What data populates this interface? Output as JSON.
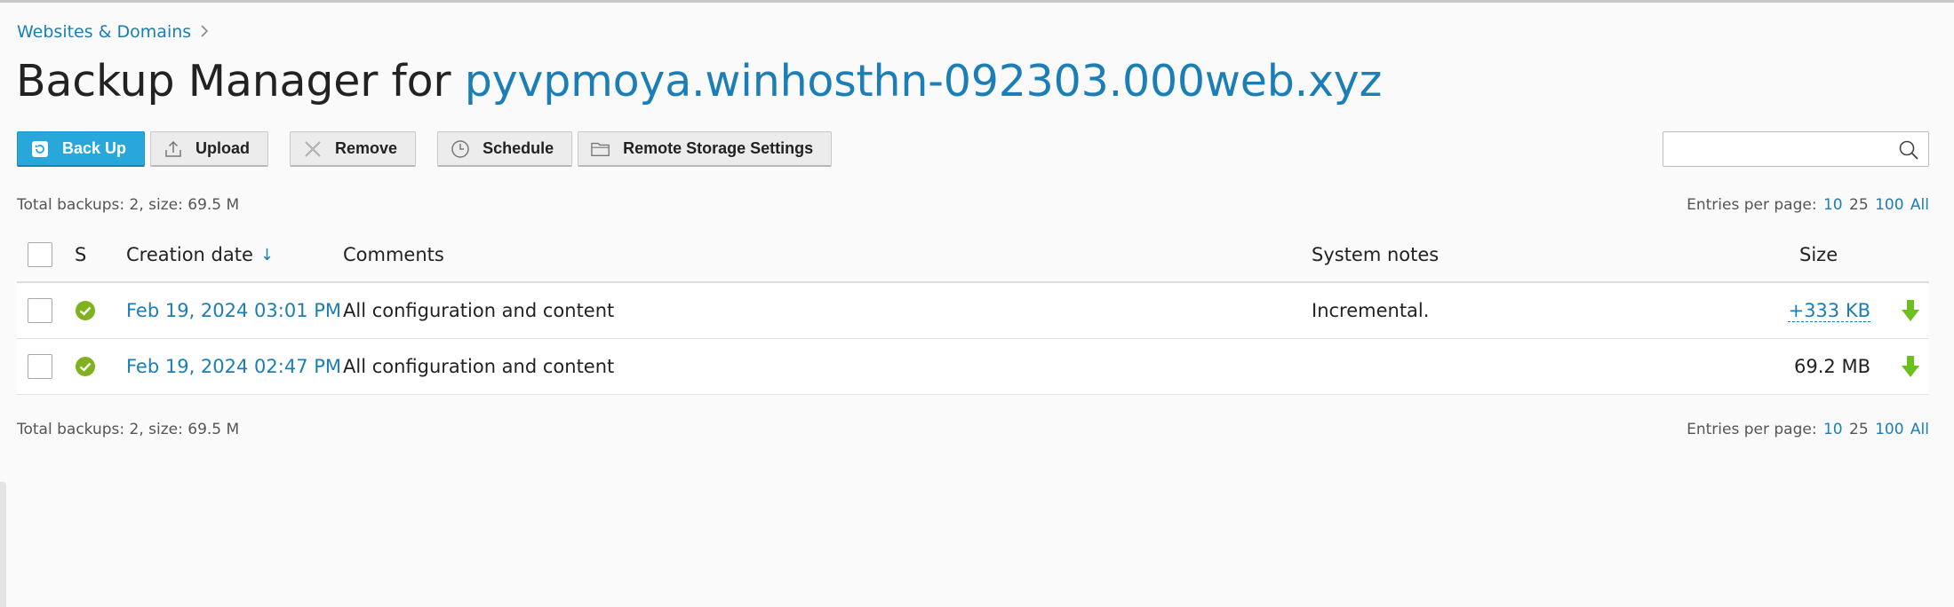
{
  "breadcrumb": {
    "items": [
      {
        "label": "Websites & Domains"
      }
    ]
  },
  "page": {
    "title_prefix": "Backup Manager for",
    "domain": "pyvpmoya.winhosthn-092303.000web.xyz"
  },
  "toolbar": {
    "backup_label": "Back Up",
    "upload_label": "Upload",
    "remove_label": "Remove",
    "schedule_label": "Schedule",
    "remote_storage_label": "Remote Storage Settings"
  },
  "search": {
    "value": "",
    "placeholder": ""
  },
  "summary": {
    "total_text": "Total backups: 2, size: 69.5 M",
    "entries_label": "Entries per page:",
    "options": [
      "10",
      "25",
      "100",
      "All"
    ],
    "current": "25"
  },
  "table": {
    "columns": {
      "status": "S",
      "creation_date": "Creation date",
      "comments": "Comments",
      "system_notes": "System notes",
      "size": "Size"
    },
    "sort_indicator": "↓",
    "rows": [
      {
        "date": "Feb 19, 2024 03:01 PM",
        "comment": "All configuration and content",
        "notes": "Incremental.",
        "size": "+333 KB"
      },
      {
        "date": "Feb 19, 2024 02:47 PM",
        "comment": "All configuration and content",
        "notes": "",
        "size": "69.2 MB"
      }
    ]
  },
  "icons": {
    "status": "check-circle-icon",
    "download": "download-arrow-icon"
  },
  "colors": {
    "accent": "#1b7eb6",
    "primary_button": "#28a7db",
    "success": "#7fb21e",
    "download": "#6cbf1c"
  }
}
